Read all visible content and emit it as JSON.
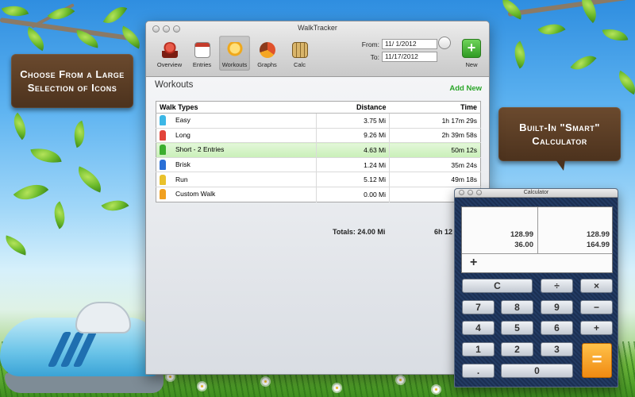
{
  "signs": {
    "left": "Choose From a Large Selection of Icons",
    "right": "Built-In \"Smart\" Calculator"
  },
  "window": {
    "title": "WalkTracker",
    "toolbar": [
      {
        "label": "Overview",
        "icon": "trophy-icon"
      },
      {
        "label": "Entries",
        "icon": "calendar-icon"
      },
      {
        "label": "Workouts",
        "icon": "lightbulb-icon",
        "active": true
      },
      {
        "label": "Graphs",
        "icon": "pie-chart-icon"
      },
      {
        "label": "Calc",
        "icon": "calculator-icon"
      }
    ],
    "from_label": "From:",
    "from_value": "11/  1/2012",
    "to_label": "To:",
    "to_value": "11/17/2012",
    "new_label": "New",
    "new_symbol": "+"
  },
  "workouts": {
    "title": "Workouts",
    "add_new": "Add New",
    "columns": [
      "Walk Types",
      "Distance",
      "Time"
    ],
    "rows": [
      {
        "type": "Easy",
        "distance": "3.75 Mi",
        "time": "1h 17m 29s",
        "color": "#3cb7e6"
      },
      {
        "type": "Long",
        "distance": "9.26 Mi",
        "time": "2h 39m 58s",
        "color": "#e2433a"
      },
      {
        "type": "Short - 2 Entries",
        "distance": "4.63 Mi",
        "time": "50m 12s",
        "color": "#3cae2e",
        "selected": true
      },
      {
        "type": "Brisk",
        "distance": "1.24 Mi",
        "time": "35m 24s",
        "color": "#2a6fd6"
      },
      {
        "type": "Run",
        "distance": "5.12 Mi",
        "time": "49m 18s",
        "color": "#e9c12c"
      },
      {
        "type": "Custom Walk",
        "distance": "0.00 Mi",
        "time": "1h",
        "color": "#f0a020"
      }
    ],
    "totals_distance": "Totals: 24.00 Mi",
    "totals_time": "6h 12"
  },
  "calculator": {
    "title": "Calculator",
    "tape_left": [
      "128.99",
      "36.00"
    ],
    "tape_right": [
      "128.99",
      "164.99"
    ],
    "operator": "+",
    "keys": {
      "clear": "C",
      "divide": "÷",
      "multiply": "×",
      "minus": "−",
      "plus": "+",
      "seven": "7",
      "eight": "8",
      "nine": "9",
      "four": "4",
      "five": "5",
      "six": "6",
      "one": "1",
      "two": "2",
      "three": "3",
      "dot": ".",
      "zero": "0",
      "equals": "="
    }
  }
}
